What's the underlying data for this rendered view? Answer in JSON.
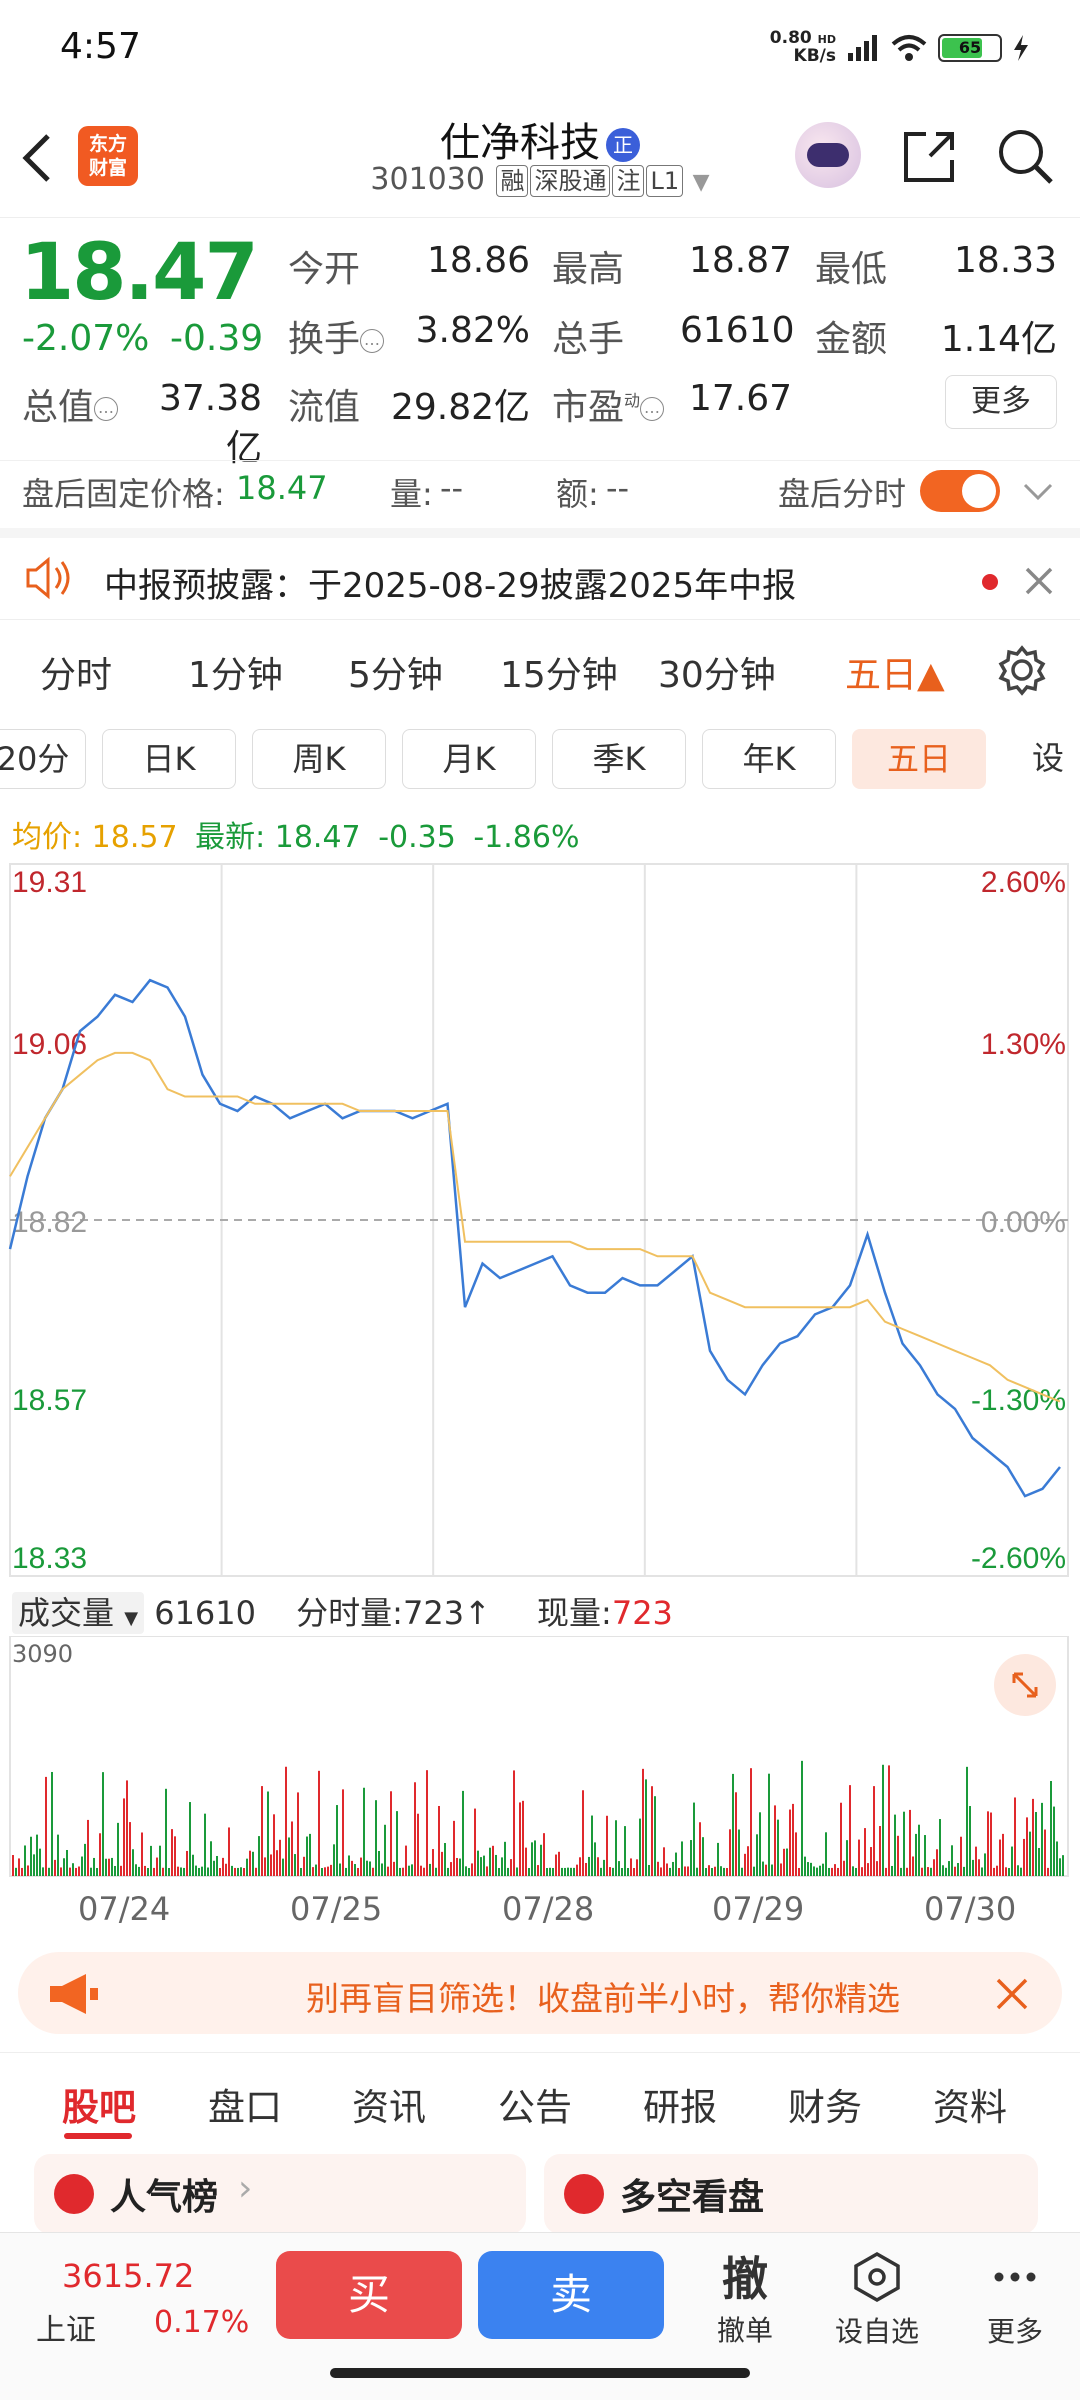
{
  "status": {
    "time": "4:57",
    "net_speed": "0.80",
    "net_unit": "KB/s",
    "hd": "HD",
    "battery": "65"
  },
  "header": {
    "logo_line1": "东方",
    "logo_line2": "财富",
    "name": "仕净科技",
    "name_badge": "正",
    "code": "301030",
    "tags": [
      "融",
      "深股通",
      "注",
      "L1"
    ]
  },
  "quote": {
    "price": "18.47",
    "pct": "-2.07%",
    "change": "-0.39",
    "open_label": "今开",
    "open": "18.86",
    "high_label": "最高",
    "high": "18.87",
    "low_label": "最低",
    "low": "18.33",
    "turnover_label": "换手",
    "turnover": "3.82%",
    "volume_label": "总手",
    "volume": "61610",
    "amount_label": "金额",
    "amount": "1.14亿",
    "mktcap_label": "总值",
    "mktcap": "37.38亿",
    "float_label": "流值",
    "float_cap": "29.82亿",
    "pe_label": "市盈",
    "pe_sup": "动",
    "pe": "17.67",
    "more": "更多"
  },
  "after_hours": {
    "label": "盘后固定价格:",
    "price": "18.47",
    "vol_label": "量:",
    "vol": "--",
    "amt_label": "额:",
    "amt": "--",
    "toggle_label": "盘后分时"
  },
  "notice": {
    "text": "中报预披露：于2025-08-29披露2025年中报"
  },
  "period_tabs": [
    "分时",
    "1分钟",
    "5分钟",
    "15分钟",
    "30分钟",
    "五日▲"
  ],
  "k_tabs": [
    "20分",
    "日K",
    "周K",
    "月K",
    "季K",
    "年K",
    "五日",
    "设"
  ],
  "legend": {
    "avg_label": "均价:",
    "avg": "18.57",
    "latest_label": "最新:",
    "latest": "18.47",
    "chg": "-0.35",
    "pct": "-1.86%"
  },
  "chart_data": {
    "type": "line",
    "y_left_ticks": [
      "19.31",
      "19.06",
      "18.82",
      "18.57",
      "18.33"
    ],
    "y_right_ticks": [
      "2.60%",
      "1.30%",
      "0.00%",
      "-1.30%",
      "-2.60%"
    ],
    "x_labels": [
      "07/24",
      "07/25",
      "07/28",
      "07/29",
      "07/30"
    ],
    "ylim": [
      18.33,
      19.31
    ],
    "series": [
      {
        "name": "price",
        "values": [
          18.78,
          18.88,
          18.96,
          19.0,
          19.08,
          19.1,
          19.13,
          19.12,
          19.15,
          19.14,
          19.1,
          19.02,
          18.98,
          18.97,
          18.99,
          18.98,
          18.96,
          18.97,
          18.98,
          18.96,
          18.97,
          18.97,
          18.97,
          18.96,
          18.97,
          18.98,
          18.7,
          18.76,
          18.74,
          18.75,
          18.76,
          18.77,
          18.73,
          18.72,
          18.72,
          18.74,
          18.73,
          18.73,
          18.75,
          18.77,
          18.64,
          18.6,
          18.58,
          18.62,
          18.65,
          18.66,
          18.69,
          18.7,
          18.73,
          18.8,
          18.72,
          18.65,
          18.62,
          18.58,
          18.56,
          18.52,
          18.5,
          18.48,
          18.44,
          18.45,
          18.48
        ]
      },
      {
        "name": "avg",
        "values": [
          18.88,
          18.92,
          18.96,
          19.0,
          19.02,
          19.04,
          19.05,
          19.05,
          19.04,
          19.0,
          18.99,
          18.99,
          18.99,
          18.99,
          18.98,
          18.98,
          18.98,
          18.98,
          18.98,
          18.98,
          18.97,
          18.97,
          18.97,
          18.97,
          18.97,
          18.97,
          18.79,
          18.79,
          18.79,
          18.79,
          18.79,
          18.79,
          18.79,
          18.78,
          18.78,
          18.78,
          18.78,
          18.77,
          18.77,
          18.77,
          18.72,
          18.71,
          18.7,
          18.7,
          18.7,
          18.7,
          18.7,
          18.7,
          18.7,
          18.71,
          18.68,
          18.67,
          18.66,
          18.65,
          18.64,
          18.63,
          18.62,
          18.6,
          18.59,
          18.58,
          18.57
        ]
      }
    ]
  },
  "volume": {
    "label": "成交量",
    "total": "61610",
    "min_label": "分时量:",
    "min_val": "723",
    "arrow": "↑",
    "now_label": "现量:",
    "now_val": "723",
    "max_tick": "3090"
  },
  "banner": {
    "text": "别再盲目筛选！收盘前半小时，帮你精选"
  },
  "content_tabs": [
    "股吧",
    "盘口",
    "资讯",
    "公告",
    "研报",
    "财务",
    "资料"
  ],
  "cards": [
    {
      "label": "人气榜"
    },
    {
      "label": "多空看盘"
    }
  ],
  "bottom": {
    "index_val": "3615.72",
    "index_name": "上证",
    "index_pct": "0.17%",
    "buy": "买",
    "sell": "卖",
    "cancel_icon": "撤",
    "cancel": "撤单",
    "watch": "设自选",
    "more": "更多"
  }
}
